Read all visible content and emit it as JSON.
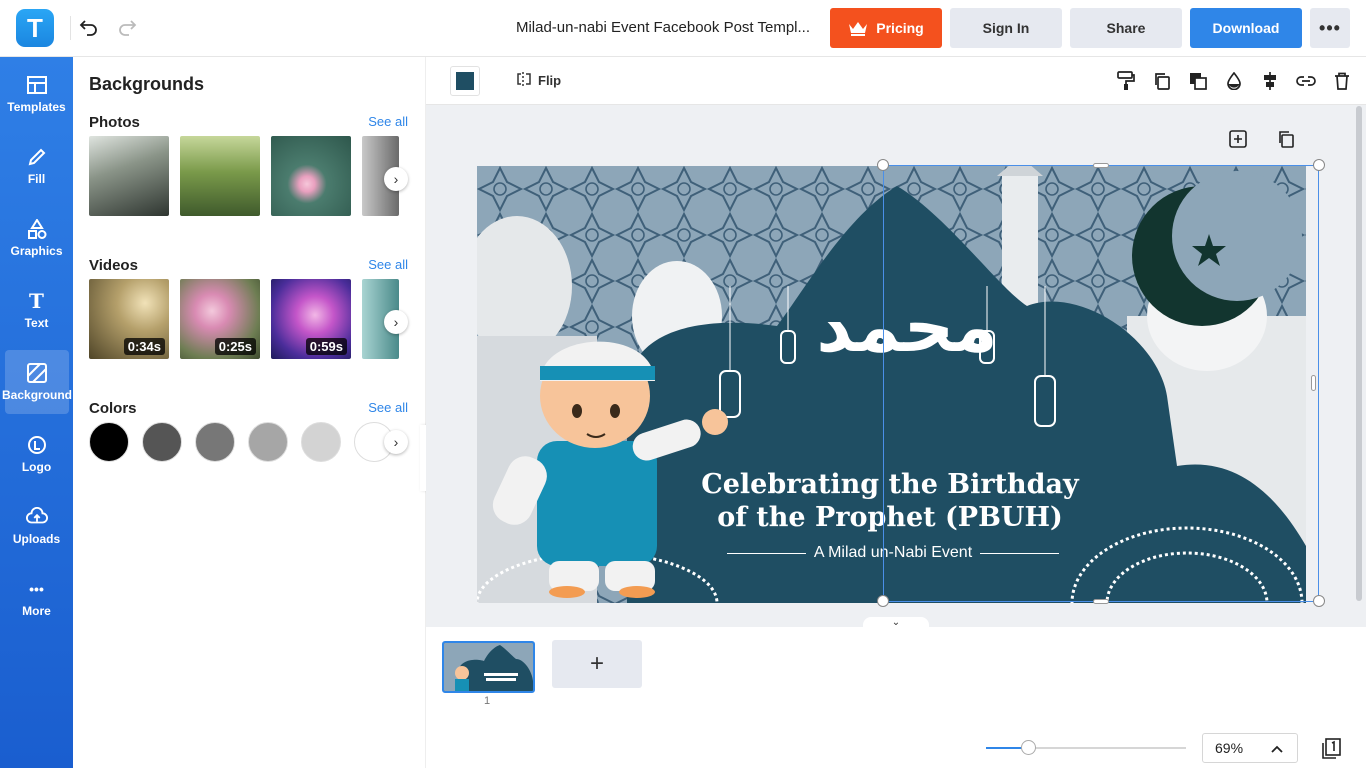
{
  "topbar": {
    "logo_letter": "T",
    "doc_title": "Milad-un-nabi Event Facebook Post Templ...",
    "pricing_label": "Pricing",
    "signin_label": "Sign In",
    "share_label": "Share",
    "download_label": "Download",
    "more_label": "•••"
  },
  "leftnav": {
    "items": [
      {
        "label": "Templates",
        "icon": "templates-icon"
      },
      {
        "label": "Fill",
        "icon": "fill-icon"
      },
      {
        "label": "Graphics",
        "icon": "graphics-icon"
      },
      {
        "label": "Text",
        "icon": "text-icon"
      },
      {
        "label": "Background",
        "icon": "background-icon"
      },
      {
        "label": "Logo",
        "icon": "logo-icon"
      },
      {
        "label": "Uploads",
        "icon": "uploads-icon"
      },
      {
        "label": "More",
        "icon": "more-icon"
      }
    ]
  },
  "panel": {
    "title": "Backgrounds",
    "photos_title": "Photos",
    "videos_title": "Videos",
    "colors_title": "Colors",
    "see_all": "See all",
    "videos": [
      {
        "duration": "0:34s"
      },
      {
        "duration": "0:25s"
      },
      {
        "duration": "0:59s"
      }
    ],
    "colors": [
      "#000000",
      "#555555",
      "#777777",
      "#a6a6a6",
      "#d3d3d3",
      "#ffffff"
    ]
  },
  "toolbar": {
    "flip_label": "Flip",
    "selected_color": "#1f4e63"
  },
  "design": {
    "arabic_text": "محمد",
    "headline_line1": "Celebrating the Birthday",
    "headline_line2": "of the Prophet (PBUH)",
    "subline": "A Milad un-Nabi Event"
  },
  "pages": {
    "current": "1",
    "add_label": "+"
  },
  "zoom": {
    "value": "69%",
    "level": 0.21
  }
}
